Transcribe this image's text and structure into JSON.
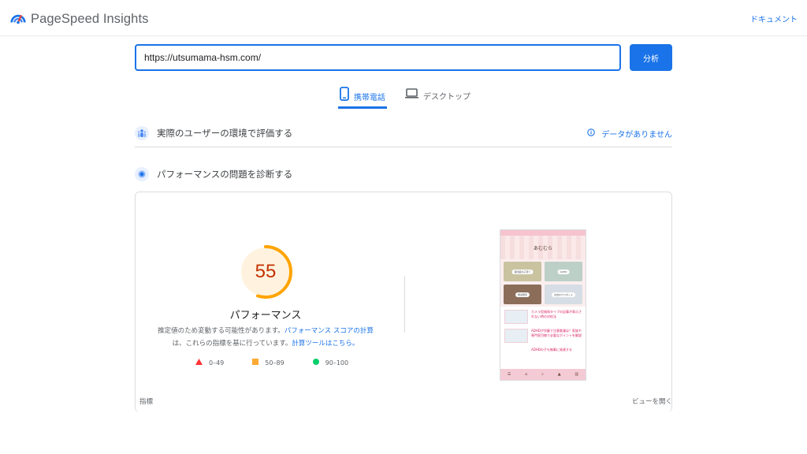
{
  "app": {
    "name": "PageSpeed Insights",
    "docs_label": "ドキュメント"
  },
  "search": {
    "url_value": "https://utsumama-hsm.com/",
    "analyze_label": "分析"
  },
  "tabs": [
    {
      "label": "携帯電話",
      "icon": "smartphone-icon",
      "active": true
    },
    {
      "label": "デスクトップ",
      "icon": "laptop-icon",
      "active": false
    }
  ],
  "field_data": {
    "title": "実際のユーザーの環境で評価する",
    "no_data": "データがありません"
  },
  "lab_data": {
    "title": "パフォーマンスの問題を診断する",
    "score": "55",
    "score_value": 55,
    "score_label": "パフォーマンス",
    "desc_1": "推定値のため変動する可能性があります。",
    "desc_link_1": "パフォーマンス スコアの計算",
    "desc_2": "は、これらの指標を基に行っています。",
    "desc_link_2": "計算ツールはこちら。",
    "legend": [
      {
        "range": "0–49",
        "color": "#ff3333",
        "shape": "triangle"
      },
      {
        "range": "50–89",
        "color": "#ffaa33",
        "shape": "square"
      },
      {
        "range": "90–100",
        "color": "#0cce6b",
        "shape": "circle"
      }
    ],
    "metrics_label": "指標",
    "view_toggle": "ビューを開く"
  },
  "screenshot": {
    "brand": "あむむら",
    "tiles": [
      "自閉症の子育て",
      "ADHD",
      "発達障害",
      "お出かけスポット"
    ],
    "tile_colors": [
      "#c9c3a0",
      "#bcd0c8",
      "#8b6d5a",
      "#d6dde4"
    ],
    "posts": [
      "カメラ型検知タイプの記事が表示されない時の対処法",
      "ADHDが児童で注意散漫は？家族や専門家目線で必要なポイントを解説"
    ],
    "teaser": "ADHDの子も無事に発達する"
  },
  "colors": {
    "accent": "#1a73e8",
    "score_fail": "#c33300",
    "score_average": "#ffa400"
  }
}
